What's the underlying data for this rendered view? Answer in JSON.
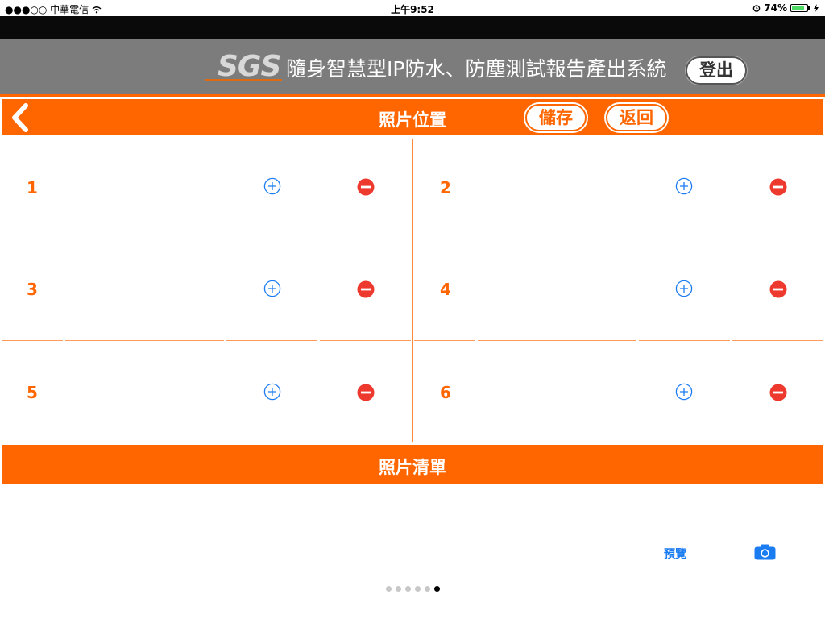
{
  "status_bar": {
    "carrier": "●●●○○ 中華電信",
    "time": "上午9:52",
    "battery": "74%",
    "battery_level": 0.74
  },
  "header": {
    "logo_text": "SGS",
    "app_title": "隨身智慧型IP防水、防塵測試報告產出系統",
    "logout_label": "登出"
  },
  "toolbar": {
    "title": "照片位置",
    "save_label": "儲存",
    "return_label": "返回"
  },
  "grid": {
    "cells": [
      {
        "number": "1"
      },
      {
        "number": "2"
      },
      {
        "number": "3"
      },
      {
        "number": "4"
      },
      {
        "number": "5"
      },
      {
        "number": "6"
      }
    ]
  },
  "photo_list": {
    "title": "照片清單",
    "preview_label": "預覽"
  },
  "page_indicator": {
    "total": 6,
    "current": 6
  },
  "colors": {
    "accent": "#ff6600",
    "header_gray": "#7c7c7c",
    "link_blue": "#1b7cf2",
    "remove_red": "#ee3a2e"
  },
  "icons": {
    "back": "chevron-left-icon",
    "add": "plus-circle-icon",
    "remove": "minus-circle-icon",
    "camera": "camera-icon",
    "wifi": "wifi-icon",
    "alarm": "alarm-icon"
  }
}
